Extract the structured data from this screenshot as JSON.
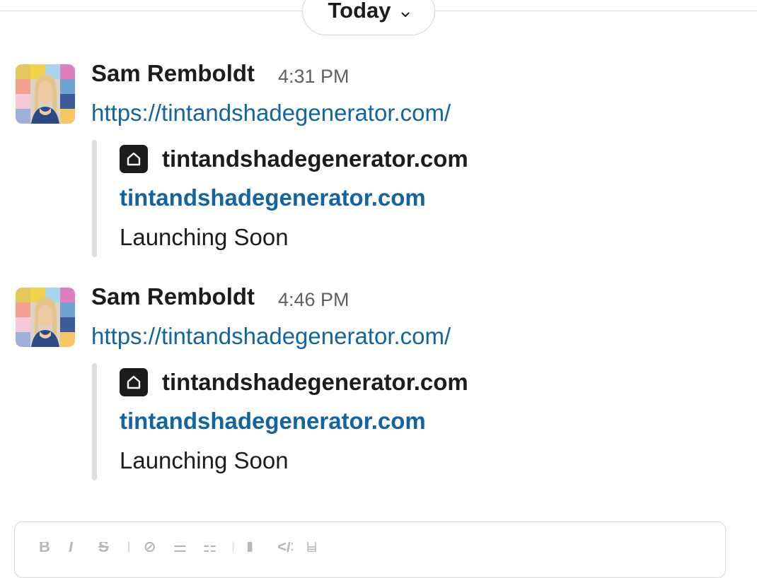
{
  "date_divider": {
    "label": "Today"
  },
  "messages": [
    {
      "author": "Sam Remboldt",
      "time": "4:31 PM",
      "link": "https://tintandshadegenerator.com/",
      "unfurl": {
        "site_name": "tintandshadegenerator.com",
        "title": "tintandshadegenerator.com",
        "description": "Launching Soon"
      }
    },
    {
      "author": "Sam Remboldt",
      "time": "4:46 PM",
      "link": "https://tintandshadegenerator.com/",
      "unfurl": {
        "site_name": "tintandshadegenerator.com",
        "title": "tintandshadegenerator.com",
        "description": "Launching Soon"
      }
    }
  ],
  "composer": {
    "toolbar_icons": [
      "bold-icon",
      "italic-icon",
      "strikethrough-icon",
      "link-icon",
      "bulleted-list-icon",
      "numbered-list-icon",
      "blockquote-icon",
      "code-icon",
      "code-block-icon"
    ]
  },
  "colors": {
    "link": "#1264a3",
    "text": "#1d1c1d",
    "muted": "#616061"
  }
}
